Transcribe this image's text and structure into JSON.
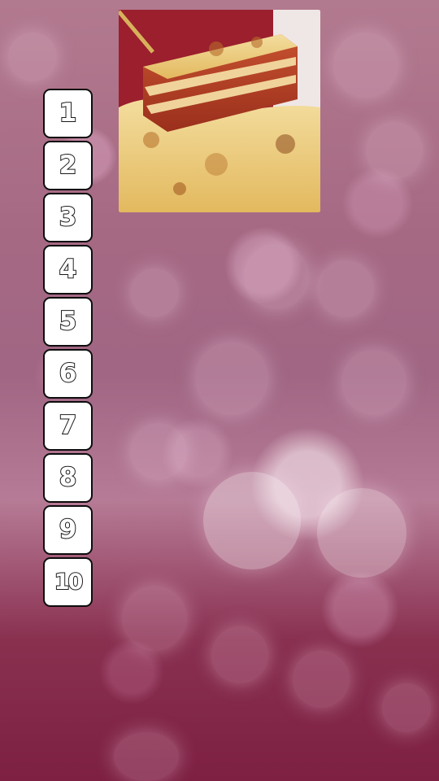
{
  "levels": [
    {
      "label": "1"
    },
    {
      "label": "2"
    },
    {
      "label": "3"
    },
    {
      "label": "4"
    },
    {
      "label": "5"
    },
    {
      "label": "6"
    },
    {
      "label": "7"
    },
    {
      "label": "8"
    },
    {
      "label": "9"
    },
    {
      "label": "10"
    }
  ]
}
